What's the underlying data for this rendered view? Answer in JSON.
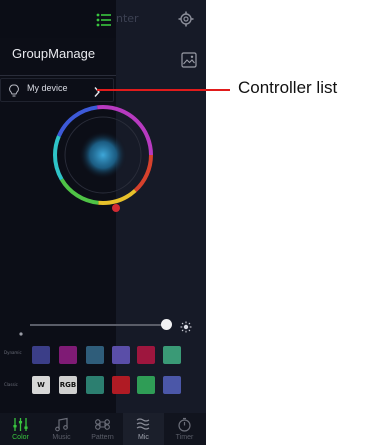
{
  "header": {
    "title_partial": "nter"
  },
  "drawer": {
    "group_title": "GroupManage",
    "device_label": "My device"
  },
  "callout": {
    "label": "Controller list"
  },
  "swatches": {
    "row1_label": "Dynamic",
    "row2_label": "Classic",
    "row1_colors": [
      "#3b3e88",
      "#7f1b75",
      "#2f5d7a",
      "#5a4ea8",
      "#9e163e",
      "#3a9a76"
    ],
    "row2_labels": [
      "W",
      "RGB"
    ],
    "row2_colors": [
      "#d7d7d7",
      "#cfcfcf",
      "#2c7f70",
      "#b01b24",
      "#2f9d56",
      "#4b57a8"
    ]
  },
  "tabs": [
    {
      "label": "Color",
      "icon": "sliders-icon",
      "active": true
    },
    {
      "label": "Music",
      "icon": "music-note-icon",
      "active": false
    },
    {
      "label": "Pattern",
      "icon": "command-icon",
      "active": false
    },
    {
      "label": "Mic",
      "icon": "waves-icon",
      "active": false
    },
    {
      "label": "Timer",
      "icon": "timer-icon",
      "active": false
    }
  ],
  "colors": {
    "accent": "#39c53f",
    "callout": "#e11b1b",
    "background": "#0b0d16"
  }
}
